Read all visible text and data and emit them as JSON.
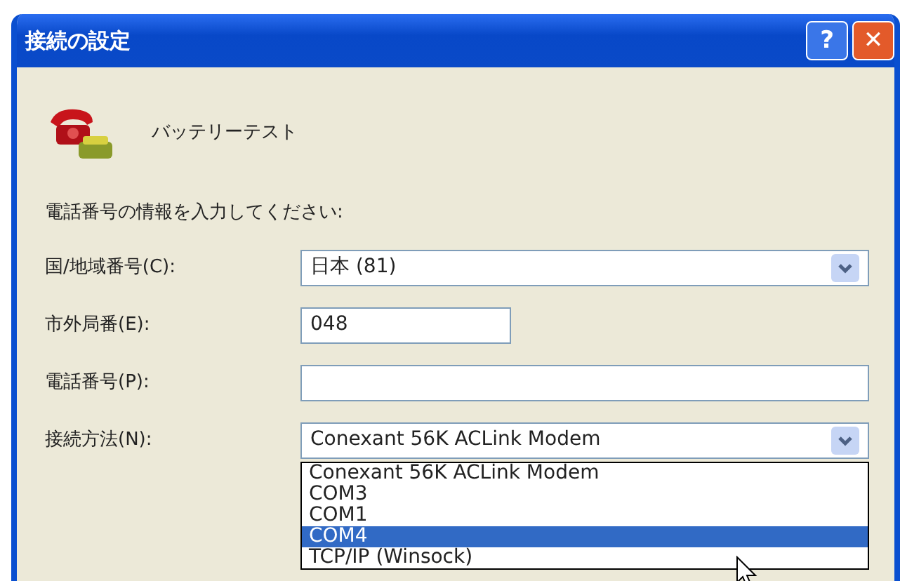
{
  "window": {
    "title": "接続の設定",
    "buttons": [
      {
        "kind": "help",
        "label": "?"
      },
      {
        "kind": "close",
        "label": "✕"
      }
    ]
  },
  "connection_name": "バッテリーテスト",
  "prompt": "電話番号の情報を入力してください:",
  "fields": [
    {
      "kind": "combo",
      "label": "国/地域番号(C):",
      "value": "日本 (81)"
    },
    {
      "kind": "short",
      "label": "市外局番(E):",
      "value": "048"
    },
    {
      "kind": "text",
      "label": "電話番号(P):"
    },
    {
      "kind": "combo",
      "label": "接続方法(N):",
      "value": "Conexant 56K ACLink Modem",
      "open": true
    }
  ],
  "dropdown_options": [
    {
      "label": "Conexant 56K ACLink Modem",
      "selected": false
    },
    {
      "label": "COM3",
      "selected": false
    },
    {
      "label": "COM1",
      "selected": false
    },
    {
      "label": "COM4",
      "selected": true
    },
    {
      "label": "TCP/IP (Winsock)",
      "selected": false
    }
  ]
}
